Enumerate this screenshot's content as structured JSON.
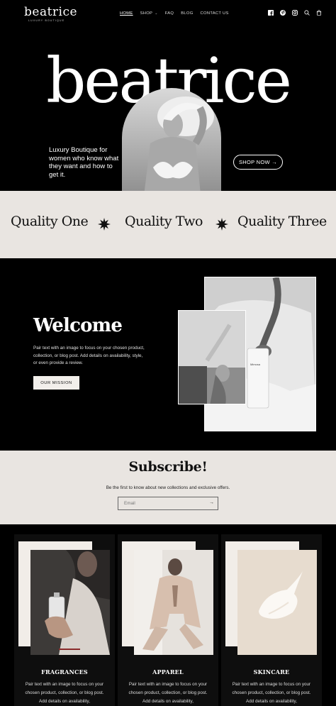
{
  "header": {
    "logo": "beatrice",
    "logo_tagline": "LUXURY BOUTIQUE",
    "nav": [
      {
        "label": "HOME",
        "active": true
      },
      {
        "label": "SHOP",
        "dropdown": true
      },
      {
        "label": "FAQ"
      },
      {
        "label": "BLOG"
      },
      {
        "label": "CONTACT US"
      }
    ],
    "icons": [
      "facebook-icon",
      "pinterest-icon",
      "instagram-icon",
      "search-icon",
      "cart-icon"
    ]
  },
  "hero": {
    "title": "beatrice",
    "tagline": "Luxury Boutique for women who know what they want and how to get it.",
    "cta": "SHOP NOW →"
  },
  "qualities": [
    "Quality One",
    "Quality Two",
    "Quality Three"
  ],
  "welcome": {
    "title": "Welcome",
    "text": "Pair text with an image to focus on your chosen product, collection, or blog post. Add details on availability, style, or even provide a review.",
    "button": "OUR MISSION"
  },
  "subscribe": {
    "title": "Subscribe!",
    "text": "Be the first to know about new collections and exclusive offers.",
    "input_placeholder": "Email",
    "submit_icon": "arrow-right-icon"
  },
  "cards": [
    {
      "title": "FRAGRANCES",
      "text": "Pair text with an image to focus on your chosen product, collection, or blog post. Add details on availability,"
    },
    {
      "title": "APPAREL",
      "text": "Pair text with an image to focus on your chosen product, collection, or blog post. Add details on availability,"
    },
    {
      "title": "SKINCARE",
      "text": "Pair text with an image to focus on your chosen product, collection, or blog post. Add details on availability,"
    }
  ],
  "colors": {
    "background": "#000000",
    "cream": "#e9e5e1",
    "text_dark": "#111111",
    "text_light": "#ffffff"
  }
}
